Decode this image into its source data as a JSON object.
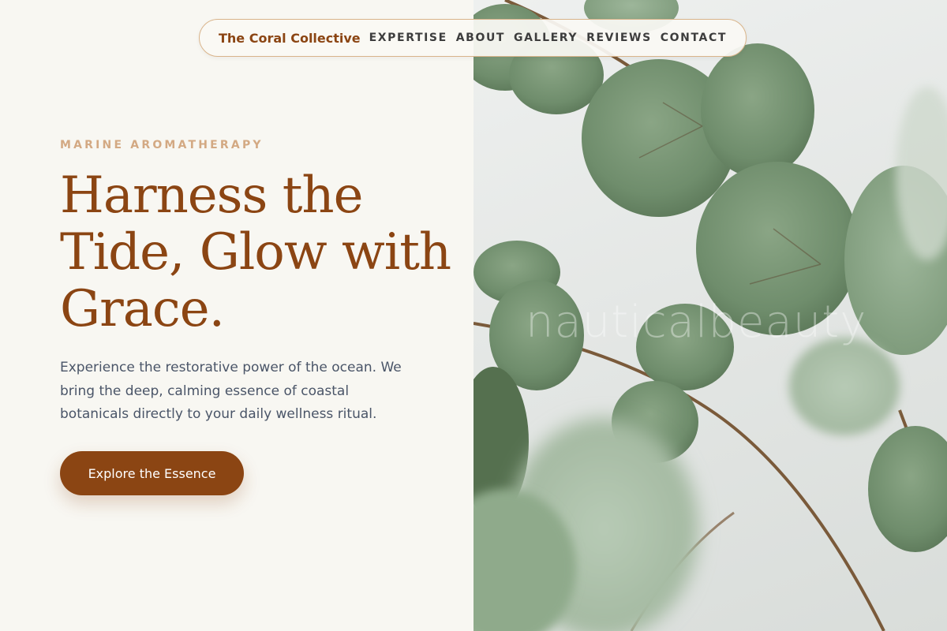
{
  "nav": {
    "brand": "The Coral Collective",
    "links": [
      "EXPERTISE",
      "ABOUT",
      "GALLERY",
      "REVIEWS",
      "CONTACT"
    ]
  },
  "hero": {
    "eyebrow": "MARINE AROMATHERAPY",
    "headline": "Harness the Tide, Glow with Grace.",
    "body": "Experience the restorative power of the ocean. We bring the deep, calming essence of coastal botanicals directly to your daily wellness ritual.",
    "cta_label": "Explore the Essence"
  },
  "image": {
    "watermark": "nauticalbeauty",
    "subject": "eucalyptus-leaves-photo"
  },
  "colors": {
    "brand": "#8b4513",
    "eyebrow": "#d3a983",
    "body_text": "#4a5568",
    "background": "#f8f7f2",
    "leaf": "#7e9a7a"
  }
}
